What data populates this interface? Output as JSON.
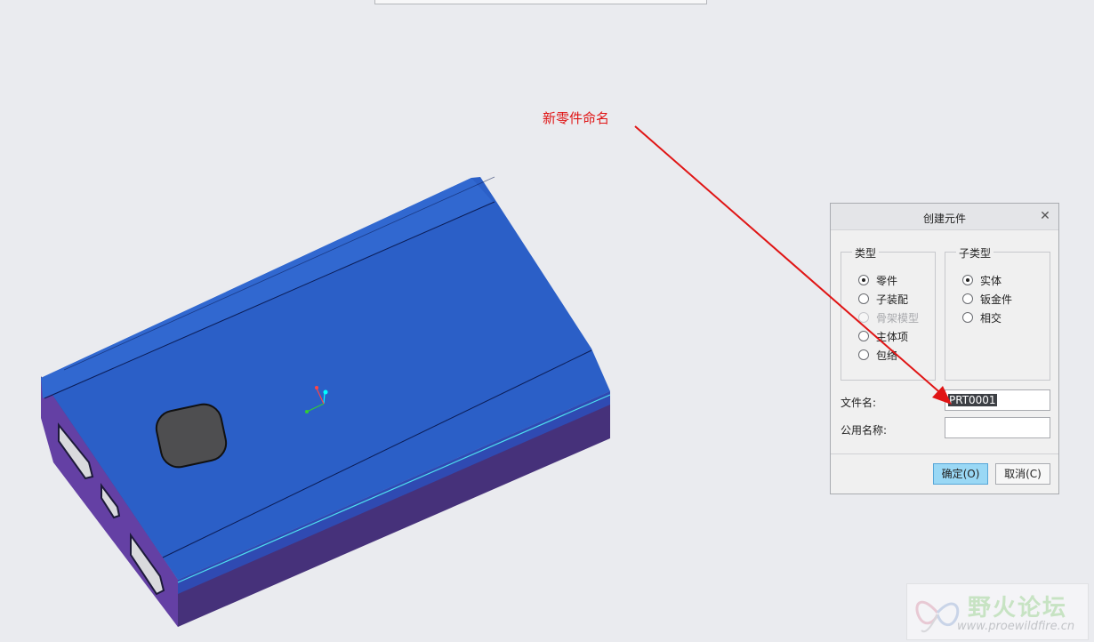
{
  "top_panel": {},
  "annotation": {
    "text": "新零件命名",
    "color": "#e01515"
  },
  "dialog": {
    "title": "创建元件",
    "close_icon": "close-icon",
    "type_group": {
      "legend": "类型",
      "options": [
        {
          "label": "零件",
          "checked": true,
          "disabled": false
        },
        {
          "label": "子装配",
          "checked": false,
          "disabled": false
        },
        {
          "label": "骨架模型",
          "checked": false,
          "disabled": true
        },
        {
          "label": "主体项",
          "checked": false,
          "disabled": false
        },
        {
          "label": "包络",
          "checked": false,
          "disabled": false
        }
      ]
    },
    "subtype_group": {
      "legend": "子类型",
      "options": [
        {
          "label": "实体",
          "checked": true,
          "disabled": false
        },
        {
          "label": "钣金件",
          "checked": false,
          "disabled": false
        },
        {
          "label": "相交",
          "checked": false,
          "disabled": false
        }
      ]
    },
    "file_name": {
      "label": "文件名:",
      "value": "PRT0001"
    },
    "common_name": {
      "label": "公用名称:",
      "value": ""
    },
    "ok_label": "确定(O)",
    "cancel_label": "取消(C)"
  },
  "model": {
    "top_color": "#2a5fc6",
    "side_color": "#4a3a8a",
    "button_color": "#4e4e50"
  },
  "watermark": {
    "title": "野火论坛",
    "url": "www.proewildfire.cn"
  }
}
